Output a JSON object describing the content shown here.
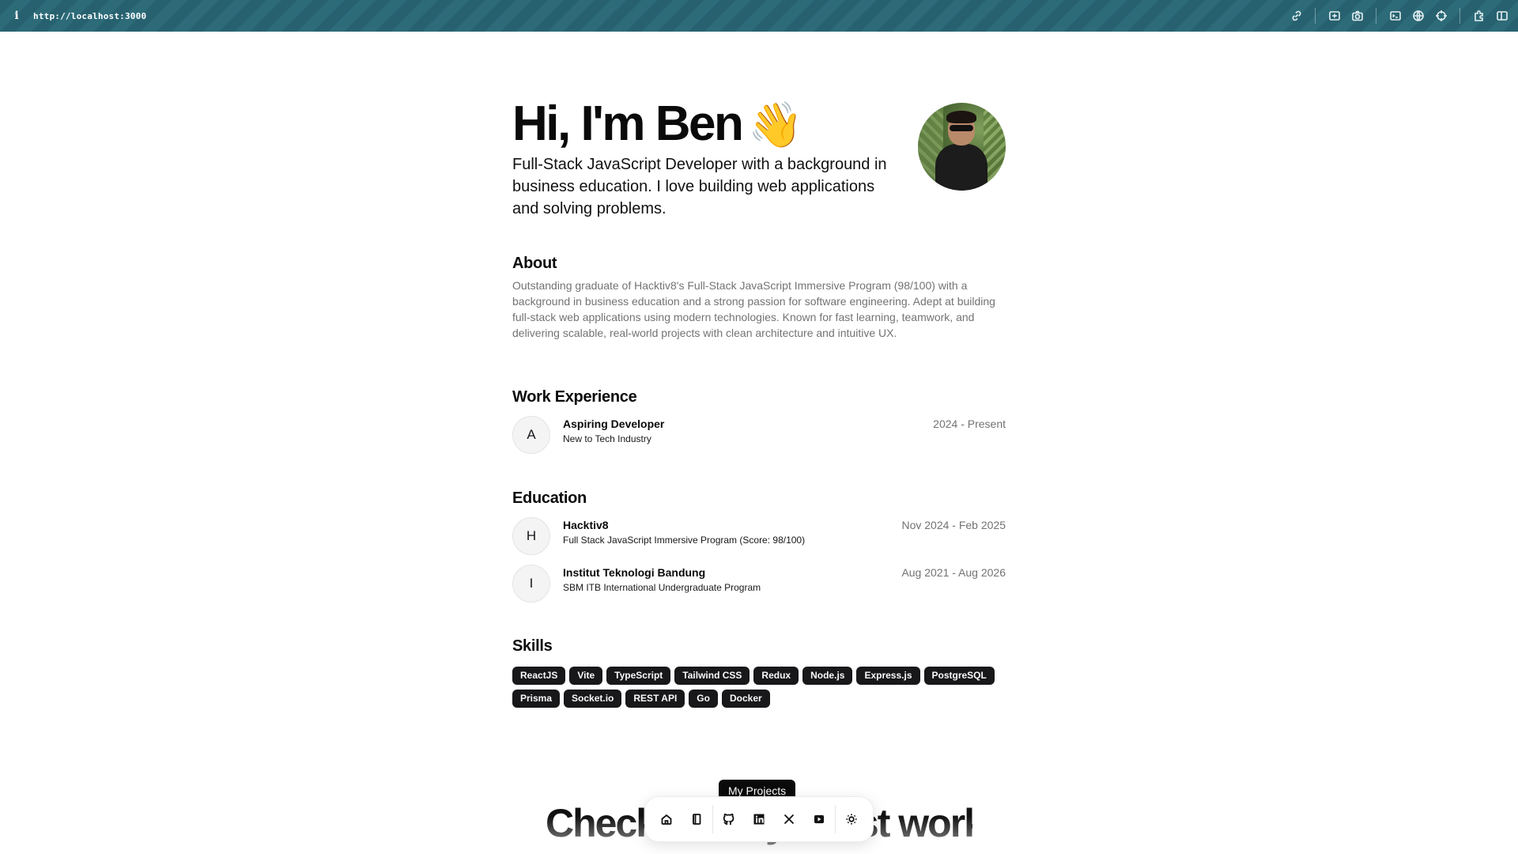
{
  "browser": {
    "info_glyph": "i",
    "url": "http://localhost:3000",
    "tools": [
      {
        "name": "link-icon"
      },
      {
        "name": "screen-capture-icon"
      },
      {
        "name": "camera-icon"
      },
      {
        "name": "terminal-icon"
      },
      {
        "name": "globe-icon"
      },
      {
        "name": "crosshair-icon"
      },
      {
        "name": "extension-icon"
      },
      {
        "name": "sidebar-icon"
      }
    ]
  },
  "hero": {
    "greeting": "Hi, I'm Ben",
    "wave": "👋",
    "subtitle": "Full-Stack JavaScript Developer with a background in business education. I love building web applications and solving problems."
  },
  "about": {
    "title": "About",
    "text": "Outstanding graduate of Hacktiv8's Full-Stack JavaScript Immersive Program (98/100) with a background in business education and a strong passion for software engineering. Adept at building full-stack web applications using modern technologies. Known for fast learning, teamwork, and delivering scalable, real-world projects with clean architecture and intuitive UX."
  },
  "work": {
    "title": "Work Experience",
    "items": [
      {
        "initial": "A",
        "name": "Aspiring Developer",
        "role": "New to Tech Industry",
        "dates": "2024 - Present"
      }
    ]
  },
  "education": {
    "title": "Education",
    "items": [
      {
        "initial": "H",
        "name": "Hacktiv8",
        "role": "Full Stack JavaScript Immersive Program (Score: 98/100)",
        "dates": "Nov 2024 - Feb 2025"
      },
      {
        "initial": "I",
        "name": "Institut Teknologi Bandung",
        "role": "SBM ITB International Undergraduate Program",
        "dates": "Aug 2021 - Aug 2026"
      }
    ]
  },
  "skills": {
    "title": "Skills",
    "items": [
      "ReactJS",
      "Vite",
      "TypeScript",
      "Tailwind CSS",
      "Redux",
      "Node.js",
      "Express.js",
      "PostgreSQL",
      "Prisma",
      "Socket.io",
      "REST API",
      "Go",
      "Docker"
    ]
  },
  "projects": {
    "pill": "My Projects",
    "heading": "Check out my latest work"
  },
  "dock": {
    "items": [
      {
        "name": "home-icon"
      },
      {
        "name": "notebook-icon"
      },
      {
        "name": "github-icon"
      },
      {
        "name": "linkedin-icon"
      },
      {
        "name": "x-icon"
      },
      {
        "name": "youtube-icon"
      },
      {
        "name": "sun-icon"
      }
    ]
  },
  "colors": {
    "toolbar": "#27616f",
    "badge": "#18181b",
    "muted_text": "#737373"
  }
}
